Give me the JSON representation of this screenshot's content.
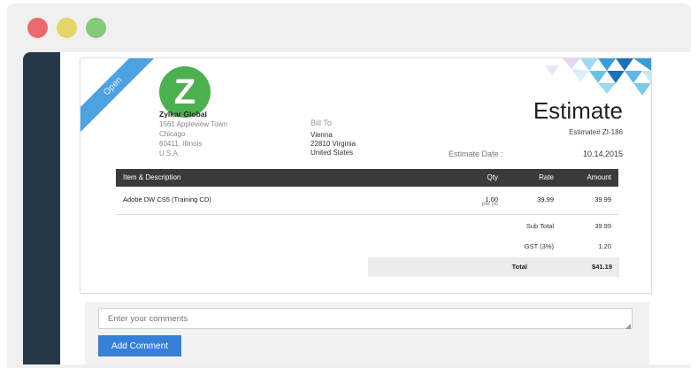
{
  "window": {
    "controls": [
      "close",
      "minimize",
      "maximize"
    ]
  },
  "document": {
    "status_ribbon": "Open",
    "logo_letter": "Z",
    "company": {
      "name": "Zylkar Global",
      "address_1": "1561 Appleview Town",
      "city": "Chicago",
      "zip_state": "60411, Illinois",
      "country": "U.S.A."
    },
    "bill_to": {
      "label": "Bill To",
      "name": "Vienna",
      "zip_state": "22810 Virginia",
      "country": "United States"
    },
    "title": "Estimate",
    "estimate_number": "Estimate# ZI-186",
    "estimate_date_label": "Estimate Date :",
    "estimate_date": "10.14.2015",
    "table": {
      "headers": {
        "item": "Item & Description",
        "qty": "Qty",
        "rate": "Rate",
        "amount": "Amount"
      },
      "rows": [
        {
          "item": "Adobe DW CS5 (Training CD)",
          "qty": "1.00",
          "unit": "per pc",
          "rate": "39.99",
          "amount": "39.99"
        }
      ]
    },
    "summary": {
      "sub_total_label": "Sub Total",
      "sub_total": "39.99",
      "gst_label": "GST (3%)",
      "gst": "1.20",
      "total_label": "Total",
      "total": "$41.19"
    }
  },
  "comments": {
    "placeholder": "Enter your comments",
    "button_label": "Add Comment"
  },
  "colors": {
    "sidebar": "#273747",
    "ribbon": "#4fa2e0",
    "logo": "#4caf50",
    "button": "#3680d8"
  }
}
